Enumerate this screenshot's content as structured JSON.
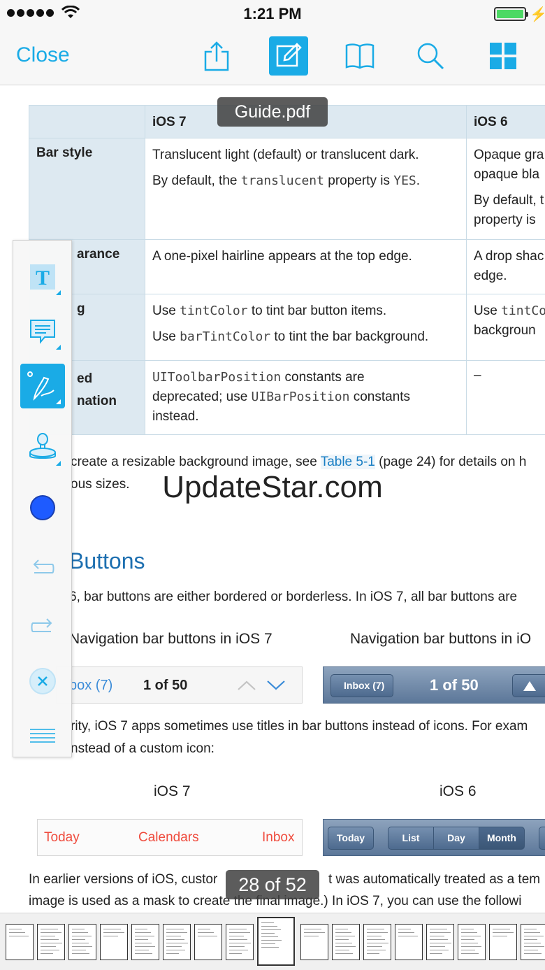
{
  "status_bar": {
    "time": "1:21 PM"
  },
  "toolbar": {
    "close_label": "Close",
    "icons": [
      "share-icon",
      "annotate-icon",
      "book-icon",
      "search-icon",
      "grid-icon"
    ],
    "accent_color": "#1aabe6"
  },
  "overlay": {
    "file_title": "Guide.pdf",
    "watermark": "UpdateStar.com",
    "page_indicator": "28 of 52"
  },
  "document": {
    "table": {
      "headers": [
        "",
        "iOS 7",
        "iOS 6"
      ],
      "rows": [
        {
          "label": "Bar style",
          "ios7": [
            "Translucent light (default) or translucent dark.",
            [
              "By default, the ",
              "translucent",
              " property is ",
              "YES",
              "."
            ]
          ],
          "ios6": [
            "Opaque gra",
            "opaque bla",
            "By default, t",
            "property is"
          ]
        },
        {
          "label": "arance",
          "ios7": [
            "A one-pixel hairline appears at the top edge."
          ],
          "ios6": [
            "A drop shac",
            "edge."
          ]
        },
        {
          "label": "g",
          "ios7": [
            [
              "Use ",
              "tintColor",
              " to tint bar button items."
            ],
            [
              "Use ",
              "barTintColor",
              " to tint the bar background."
            ]
          ],
          "ios6": [
            [
              "Use ",
              "tintCo"
            ],
            "backgroun"
          ]
        },
        {
          "label_lines": [
            "ed",
            "nation"
          ],
          "ios7": [
            [
              "UIToolbarPosition",
              " constants are"
            ],
            [
              "deprecated; use ",
              "UIBarPosition",
              " constants"
            ],
            "instead."
          ],
          "ios6": [
            "–"
          ]
        }
      ]
    },
    "para1_a": "create a resizable background image, see ",
    "para1_link": "Table 5-1",
    "para1_b": " (page 24) for details on h",
    "para1_line2": "ous sizes.",
    "heading": "Buttons",
    "para2": "6, bar buttons are either bordered or borderless. In iOS 7, all bar buttons are",
    "caption_left": "Navigation bar buttons in iOS 7",
    "caption_right": "Navigation bar buttons in iO",
    "nav7": {
      "back": "box (7)",
      "count": "1 of 50"
    },
    "nav6": {
      "back": "Inbox (7)",
      "count": "1 of 50"
    },
    "para3_line1": "rity, iOS 7 apps sometimes use titles in bar buttons instead of icons. For exam",
    "para3_line2": "nstead of a custom icon:",
    "label_ios7": "iOS 7",
    "label_ios6": "iOS 6",
    "tabs7": [
      "Today",
      "Calendars",
      "Inbox"
    ],
    "tabs6": [
      "Today",
      "List",
      "Day",
      "Month"
    ],
    "para4_line1": "In earlier versions of iOS, custor",
    "para4_line1b": "t was automatically treated as a tem",
    "para4_line2": "image is used as a mask to create the final image.) In iOS 7, you can use the followi"
  },
  "palette": {
    "tools": [
      "text-tool-icon",
      "note-tool-icon",
      "pen-tool-icon",
      "stamp-tool-icon",
      "color-swatch-icon",
      "undo-icon",
      "redo-icon",
      "clear-icon",
      "palette-menu-icon"
    ],
    "selected_color": "#1e5bff"
  },
  "thumbnails": {
    "count": 17,
    "current_index": 8
  }
}
